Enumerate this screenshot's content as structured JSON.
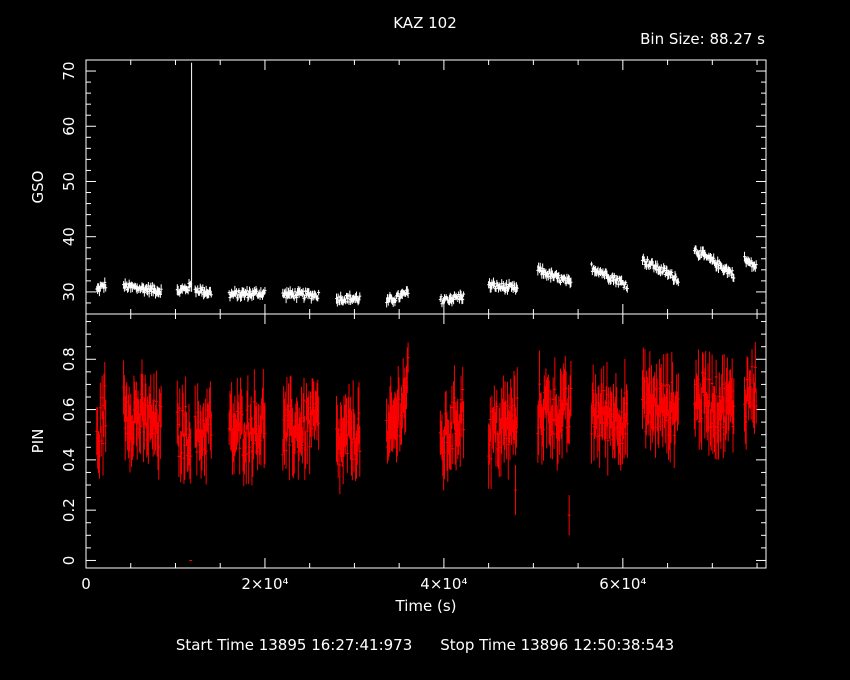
{
  "header": {
    "title": "KAZ 102",
    "bin_size": "Bin Size: 88.27 s"
  },
  "footer": {
    "start": "Start Time 13895 16:27:41:973",
    "stop": "Stop Time 13896 12:50:38:543"
  },
  "colors": {
    "background": "#000000",
    "axes": "#ffffff",
    "gso_series": "#ffffff",
    "pin_series": "#ff0000"
  },
  "chart_data": [
    {
      "type": "scatter",
      "panel": "top",
      "title": "KAZ 102",
      "ylabel": "GSO",
      "xlim": [
        0,
        76000
      ],
      "ylim": [
        26,
        72
      ],
      "yticks": [
        30,
        40,
        50,
        60,
        70
      ],
      "error_bars": true,
      "series": [
        {
          "color": "#ffffff",
          "segments": [
            {
              "x0": 1200,
              "x1": 2200,
              "y0": 30.3,
              "y1": 31.3
            },
            {
              "x0": 4200,
              "x1": 8400,
              "y0": 31.0,
              "y1": 30.2
            },
            {
              "x0": 10200,
              "x1": 11700,
              "y0": 30.0,
              "y1": 31.0
            },
            {
              "x0": 12200,
              "x1": 14000,
              "y0": 30.5,
              "y1": 29.8
            },
            {
              "x0": 16000,
              "x1": 20000,
              "y0": 29.5,
              "y1": 29.8
            },
            {
              "x0": 22000,
              "x1": 26000,
              "y0": 29.6,
              "y1": 29.4
            },
            {
              "x0": 28000,
              "x1": 30600,
              "y0": 28.8,
              "y1": 28.8
            },
            {
              "x0": 33600,
              "x1": 36000,
              "y0": 28.2,
              "y1": 29.8
            },
            {
              "x0": 39600,
              "x1": 42200,
              "y0": 28.5,
              "y1": 29.2
            },
            {
              "x0": 45000,
              "x1": 48200,
              "y0": 31.2,
              "y1": 30.5
            },
            {
              "x0": 50500,
              "x1": 54200,
              "y0": 34.0,
              "y1": 31.5
            },
            {
              "x0": 56500,
              "x1": 60500,
              "y0": 34.5,
              "y1": 31.2
            },
            {
              "x0": 62200,
              "x1": 66200,
              "y0": 35.8,
              "y1": 32.3
            },
            {
              "x0": 68000,
              "x1": 72400,
              "y0": 37.6,
              "y1": 33.2
            },
            {
              "x0": 73600,
              "x1": 74900,
              "y0": 35.8,
              "y1": 34.5
            }
          ],
          "spikes": [
            {
              "x": 11800,
              "y": 71.5
            }
          ]
        }
      ]
    },
    {
      "type": "scatter",
      "panel": "bottom",
      "xlabel": "Time (s)",
      "ylabel": "PIN",
      "xlim": [
        0,
        76000
      ],
      "ylim": [
        -0.03,
        0.98
      ],
      "yticks": [
        0,
        0.2,
        0.4,
        0.6,
        0.8
      ],
      "xticks": [
        0,
        20000,
        40000,
        60000
      ],
      "xticklabels": [
        "0",
        "2×10⁴",
        "4×10⁴",
        "6×10⁴"
      ],
      "error_bars": true,
      "series": [
        {
          "color": "#ff0000",
          "segments": [
            {
              "x0": 1200,
              "x1": 2200,
              "y0": 0.45,
              "y1": 0.62
            },
            {
              "x0": 4200,
              "x1": 8400,
              "y0": 0.6,
              "y1": 0.52
            },
            {
              "x0": 10200,
              "x1": 11700,
              "y0": 0.5,
              "y1": 0.52
            },
            {
              "x0": 12200,
              "x1": 14000,
              "y0": 0.48,
              "y1": 0.55
            },
            {
              "x0": 16000,
              "x1": 20000,
              "y0": 0.5,
              "y1": 0.55
            },
            {
              "x0": 22000,
              "x1": 26000,
              "y0": 0.5,
              "y1": 0.55
            },
            {
              "x0": 28000,
              "x1": 30600,
              "y0": 0.45,
              "y1": 0.52
            },
            {
              "x0": 33600,
              "x1": 36000,
              "y0": 0.45,
              "y1": 0.7
            },
            {
              "x0": 39600,
              "x1": 42200,
              "y0": 0.45,
              "y1": 0.6
            },
            {
              "x0": 45000,
              "x1": 48200,
              "y0": 0.5,
              "y1": 0.55
            },
            {
              "x0": 50500,
              "x1": 54200,
              "y0": 0.6,
              "y1": 0.58
            },
            {
              "x0": 56500,
              "x1": 60500,
              "y0": 0.58,
              "y1": 0.57
            },
            {
              "x0": 62200,
              "x1": 66200,
              "y0": 0.62,
              "y1": 0.6
            },
            {
              "x0": 68000,
              "x1": 72400,
              "y0": 0.65,
              "y1": 0.6
            },
            {
              "x0": 73600,
              "x1": 74900,
              "y0": 0.65,
              "y1": 0.7
            }
          ],
          "outliers": [
            {
              "x": 54000,
              "y": 0.18,
              "err": 0.08
            },
            {
              "x": 48000,
              "y": 0.28,
              "err": 0.1
            },
            {
              "x": 11700,
              "y": 0.0,
              "err": 0.0
            }
          ]
        }
      ]
    }
  ]
}
